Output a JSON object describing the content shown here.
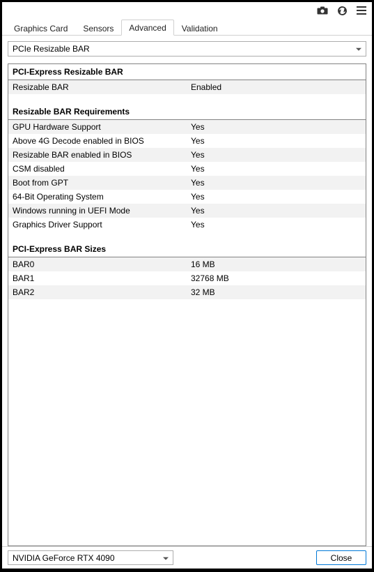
{
  "toolbar": {
    "camera_icon": "camera",
    "refresh_icon": "refresh",
    "menu_icon": "menu"
  },
  "tabs": [
    {
      "label": "Graphics Card",
      "active": false
    },
    {
      "label": "Sensors",
      "active": false
    },
    {
      "label": "Advanced",
      "active": true
    },
    {
      "label": "Validation",
      "active": false
    }
  ],
  "dropdown": {
    "selected": "PCIe Resizable BAR"
  },
  "sections": [
    {
      "title": "PCI-Express Resizable BAR",
      "rows": [
        {
          "label": "Resizable BAR",
          "value": "Enabled"
        }
      ]
    },
    {
      "title": "Resizable BAR Requirements",
      "rows": [
        {
          "label": "GPU Hardware Support",
          "value": "Yes"
        },
        {
          "label": "Above 4G Decode enabled in BIOS",
          "value": "Yes"
        },
        {
          "label": "Resizable BAR enabled in BIOS",
          "value": "Yes"
        },
        {
          "label": "CSM disabled",
          "value": "Yes"
        },
        {
          "label": "Boot from GPT",
          "value": "Yes"
        },
        {
          "label": "64-Bit Operating System",
          "value": "Yes"
        },
        {
          "label": "Windows running in UEFI Mode",
          "value": "Yes"
        },
        {
          "label": "Graphics Driver Support",
          "value": "Yes"
        }
      ]
    },
    {
      "title": "PCI-Express BAR Sizes",
      "rows": [
        {
          "label": "BAR0",
          "value": "16 MB"
        },
        {
          "label": "BAR1",
          "value": "32768 MB"
        },
        {
          "label": "BAR2",
          "value": "32 MB"
        }
      ]
    }
  ],
  "footer": {
    "gpu_selected": "NVIDIA GeForce RTX 4090",
    "close_label": "Close"
  }
}
